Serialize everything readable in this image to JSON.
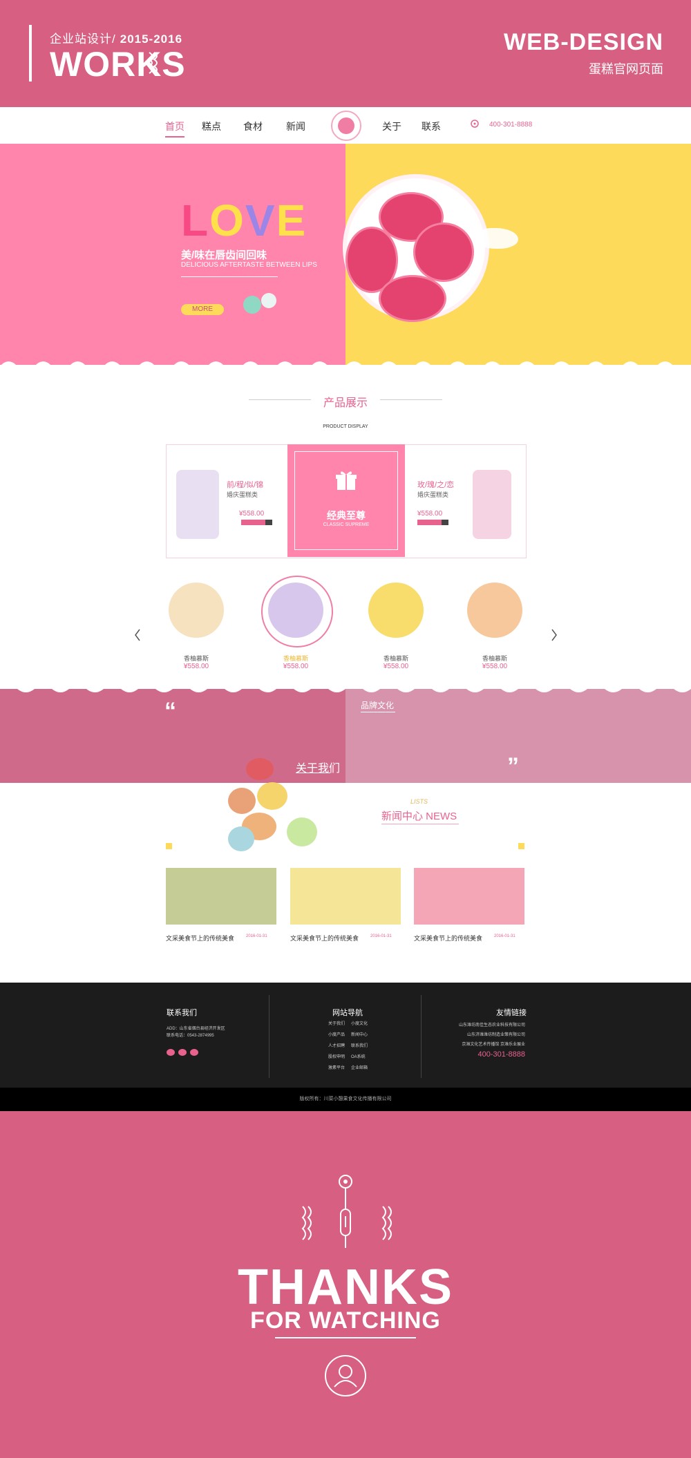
{
  "header": {
    "subtitle": "企业站设计/",
    "years": "2015-2016",
    "works": "WORKS",
    "right_title": "WEB-DESIGN",
    "right_sub": "蛋糕官网页面"
  },
  "nav": {
    "items": [
      "首页",
      "糕点",
      "食材",
      "新闻",
      "关于",
      "联系"
    ],
    "phone": "400-301-8888"
  },
  "hero": {
    "love": "LOVE",
    "headline": "美/味在唇齿间回味",
    "subheadline": "DELICIOUS AFTERTASTE BETWEEN LIPS",
    "more": "MORE"
  },
  "products": {
    "title": "产品展示",
    "subtitle": "PRODUCT DISPLAY",
    "left": {
      "name": "前/程/似/锦",
      "type": "婚庆蛋糕类",
      "price": "¥558.00"
    },
    "center": {
      "title": "经典至尊",
      "sub": "CLASSIC SUPREME"
    },
    "right": {
      "name": "玫/瑰/之/恋",
      "type": "婚庆蛋糕类",
      "price": "¥558.00"
    },
    "cakes": [
      {
        "name": "香柚慕斯",
        "price": "¥558.00"
      },
      {
        "name": "香柚慕斯",
        "price": "¥558.00"
      },
      {
        "name": "香柚慕斯",
        "price": "¥558.00"
      },
      {
        "name": "香柚慕斯",
        "price": "¥558.00"
      }
    ]
  },
  "about": {
    "brand_title": "品牌文化",
    "about_link": "关于我们"
  },
  "news": {
    "title": "新闻中心 NEWS",
    "badge": "LISTS",
    "items": [
      {
        "title": "文采美食节上的传统美食",
        "date": "2016-01-31"
      },
      {
        "title": "文采美食节上的传统美食",
        "date": "2016-01-31"
      },
      {
        "title": "文采美食节上的传统美食",
        "date": "2016-01-31"
      }
    ]
  },
  "footer": {
    "contact_title": "联系我们",
    "address": "ADD：山东省烟台县经济开发区",
    "phone": "联系电话：0543-2874995",
    "nav_title": "网站导航",
    "nav_col1": [
      "关于我们",
      "小度产品",
      "人才招聘",
      "股权申明",
      "激素平台"
    ],
    "nav_col2": [
      "小度文化",
      "新闻中心",
      "联系我们",
      "OA系统",
      "企业邮箱"
    ],
    "links_title": "友情链接",
    "links": [
      "山东潍坊南佳生态农业科技有限公司",
      "山东济潍潍坊制造业策有限公司",
      "京潍文化艺术传播馆 京潍乐业展业"
    ],
    "hotline": "400-301-8888",
    "copyright": "版权所有：川菜小憩果食文化传播有限公司"
  },
  "closing": {
    "thanks": "THANKS",
    "watching": "FOR WATCHING"
  },
  "colors": {
    "brand_pink": "#d75f82",
    "hero_pink": "#ff85ad",
    "hero_yellow": "#fdda5a",
    "accent": "#e8628e"
  }
}
